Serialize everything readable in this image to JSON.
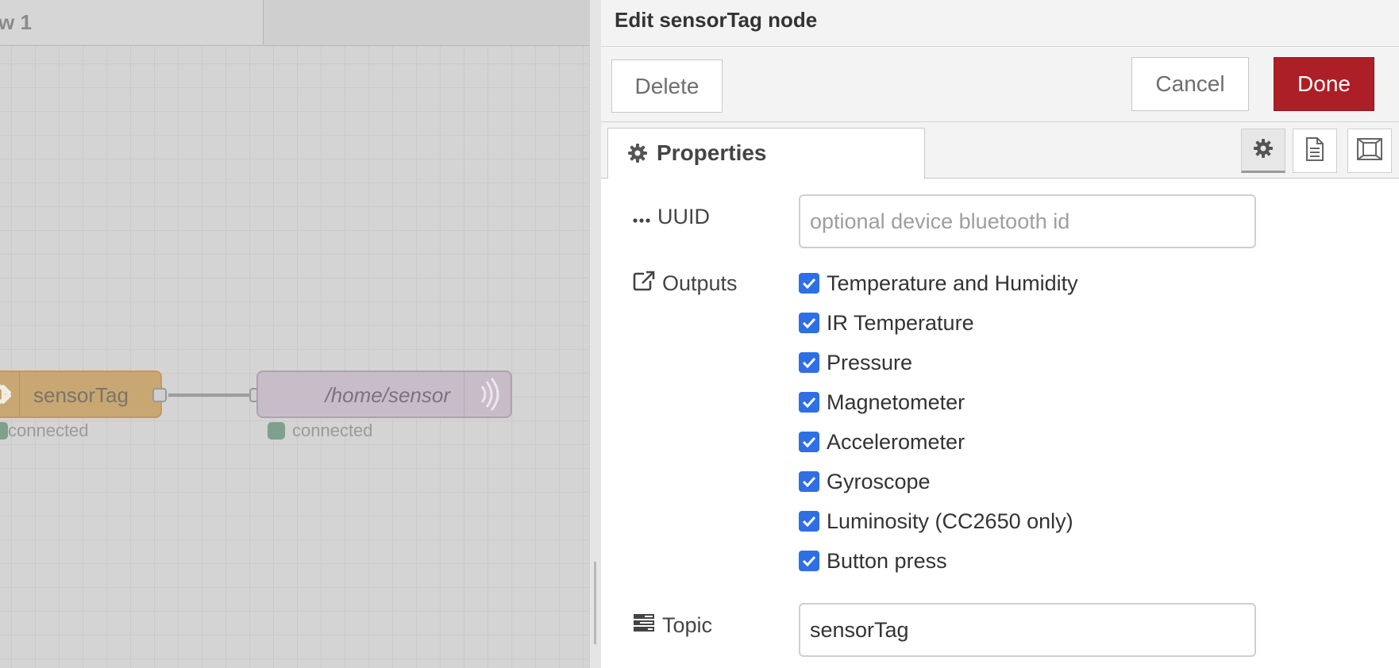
{
  "workspace": {
    "tab_label": "w 1",
    "nodes": {
      "sensortag": {
        "label": "sensorTag",
        "status": "connected"
      },
      "mqtt": {
        "label": "/home/sensor",
        "status": "connected"
      }
    }
  },
  "editor": {
    "title": "Edit sensorTag node",
    "buttons": {
      "delete": "Delete",
      "cancel": "Cancel",
      "done": "Done"
    },
    "tabs": {
      "properties": "Properties"
    },
    "form": {
      "uuid": {
        "label": "UUID",
        "value": "",
        "placeholder": "optional device bluetooth id"
      },
      "outputs": {
        "label": "Outputs",
        "options": [
          {
            "label": "Temperature and Humidity",
            "checked": true
          },
          {
            "label": "IR Temperature",
            "checked": true
          },
          {
            "label": "Pressure",
            "checked": true
          },
          {
            "label": "Magnetometer",
            "checked": true
          },
          {
            "label": "Accelerometer",
            "checked": true
          },
          {
            "label": "Gyroscope",
            "checked": true
          },
          {
            "label": "Luminosity (CC2650 only)",
            "checked": true
          },
          {
            "label": "Button press",
            "checked": true
          }
        ]
      },
      "topic": {
        "label": "Topic",
        "value": "sensorTag"
      }
    }
  },
  "colors": {
    "done_button": "#ad1f27",
    "checkbox": "#2e6fe5",
    "sensortag_node": "#c8a772",
    "mqtt_node": "#c9bcc9"
  }
}
